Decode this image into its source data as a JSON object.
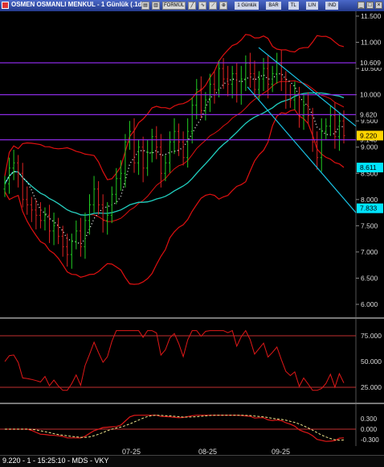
{
  "window": {
    "title": "OSMEN OSMANLI MENKUL - 1 Günlük (.1d)",
    "toolbar": [
      "FORMÜL",
      "1 Günlük",
      "BAR",
      "TL",
      "LIN",
      "IND"
    ]
  },
  "colors": {
    "level_line": "#8a2be2",
    "channel": "#19c4e6",
    "bollinger": "#e01010",
    "ma_long": "#20d0c0",
    "ma_short_dots": "#ffffff",
    "candle_up": "#22cc22",
    "candle_down": "#dd2222",
    "highlight_label": "#00e5ff",
    "current_price_label": "#ffd400"
  },
  "price_axis": [
    "11.500",
    "11.000",
    "10.500",
    "10.000",
    "9.500",
    "9.000",
    "8.500",
    "8.000",
    "7.500",
    "7.000",
    "6.500",
    "6.000"
  ],
  "level_labels": [
    "10.609",
    "10.000",
    "9.620",
    "9.140"
  ],
  "highlight_labels": [
    "8.611",
    "7.833"
  ],
  "current_price": "9.220",
  "rsi_axis": [
    "75.000",
    "50.000",
    "25.000"
  ],
  "macd_axis": [
    "0.300",
    "0.000",
    "-0.300"
  ],
  "x_labels": [
    "07-25",
    "08-25",
    "09-25"
  ],
  "status": "9.220 - 1 - 15:25:10 - MDS - VKY",
  "chart_data": {
    "type": "candlestick",
    "x": [
      "07-25",
      "08-25",
      "09-25"
    ],
    "ylim": [
      5.85,
      11.65
    ],
    "levels": [
      10.609,
      10.0,
      9.62,
      9.14
    ],
    "close": [
      8.3,
      8.6,
      8.7,
      8.5,
      8.0,
      7.9,
      7.8,
      7.7,
      7.6,
      7.7,
      7.4,
      7.5,
      7.3,
      7.1,
      6.95,
      7.2,
      7.4,
      7.1,
      7.6,
      7.9,
      8.2,
      7.9,
      7.6,
      7.7,
      8.1,
      8.4,
      8.5,
      9.1,
      9.3,
      8.7,
      9.0,
      8.6,
      8.9,
      9.2,
      9.0,
      8.5,
      8.7,
      9.1,
      9.3,
      9.1,
      8.8,
      9.3,
      9.8,
      10.1,
      9.7,
      9.9,
      10.2,
      10.1,
      10.5,
      10.3,
      10.2,
      10.4,
      10.0,
      10.3,
      10.6,
      10.4,
      10.1,
      10.3,
      10.5,
      10.2,
      10.4,
      10.6,
      10.3,
      10.0,
      9.9,
      10.0,
      9.6,
      9.8,
      9.6,
      9.1,
      8.8,
      9.3,
      9.4,
      9.6,
      9.2,
      9.5,
      9.22
    ]
  }
}
